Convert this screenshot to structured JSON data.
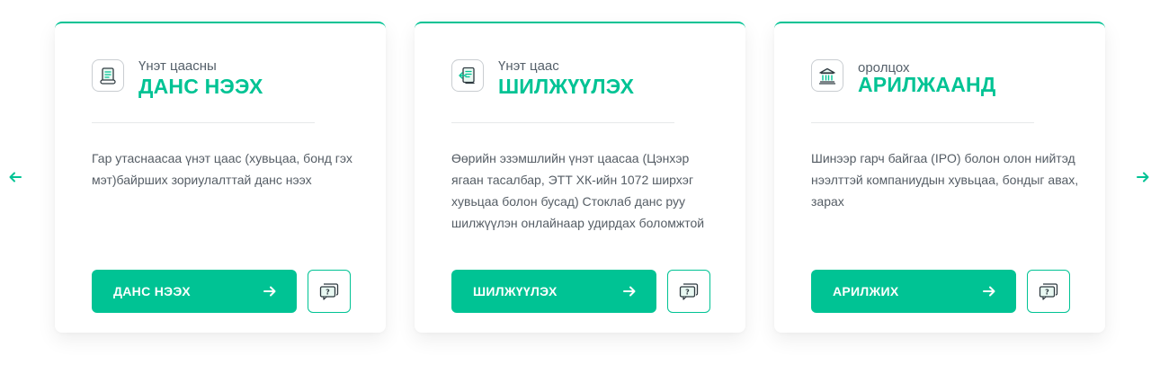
{
  "carousel": {
    "prev_icon": "arrow-left-icon",
    "next_icon": "arrow-right-icon",
    "accent_color": "#00c394"
  },
  "cards": [
    {
      "icon": "document-scroll-icon",
      "subtitle": "Үнэт цаасны",
      "title": "ДАНС НЭЭХ",
      "description": "Гар утаснаасаа үнэт цаас (хувьцаа, бонд гэх мэт)байрших зориулалттай данс нээх",
      "button_label": "ДАНС НЭЭХ",
      "help_icon": "help-chat-icon"
    },
    {
      "icon": "document-transfer-icon",
      "subtitle": "Үнэт цаас",
      "title": "ШИЛЖҮҮЛЭХ",
      "description": "Өөрийн эзэмшлийн үнэт цаасаа (Цэнхэр ягаан тасалбар, ЭТТ ХК-ийн 1072 ширхэг хувьцаа болон бусад) Стоклаб данс руу шилжүүлэн онлайнаар удирдах боломжтой",
      "button_label": "ШИЛЖҮҮЛЭХ",
      "help_icon": "help-chat-icon"
    },
    {
      "icon": "bank-building-icon",
      "title": "АРИЛЖААНД",
      "subtitle": "оролцох",
      "description": "Шинээр гарч байгаа (IPO) болон олон нийтэд нээлттэй компаниудын хувьцаа, бондыг авах, зарах",
      "button_label": "АРИЛЖИХ",
      "help_icon": "help-chat-icon"
    }
  ]
}
